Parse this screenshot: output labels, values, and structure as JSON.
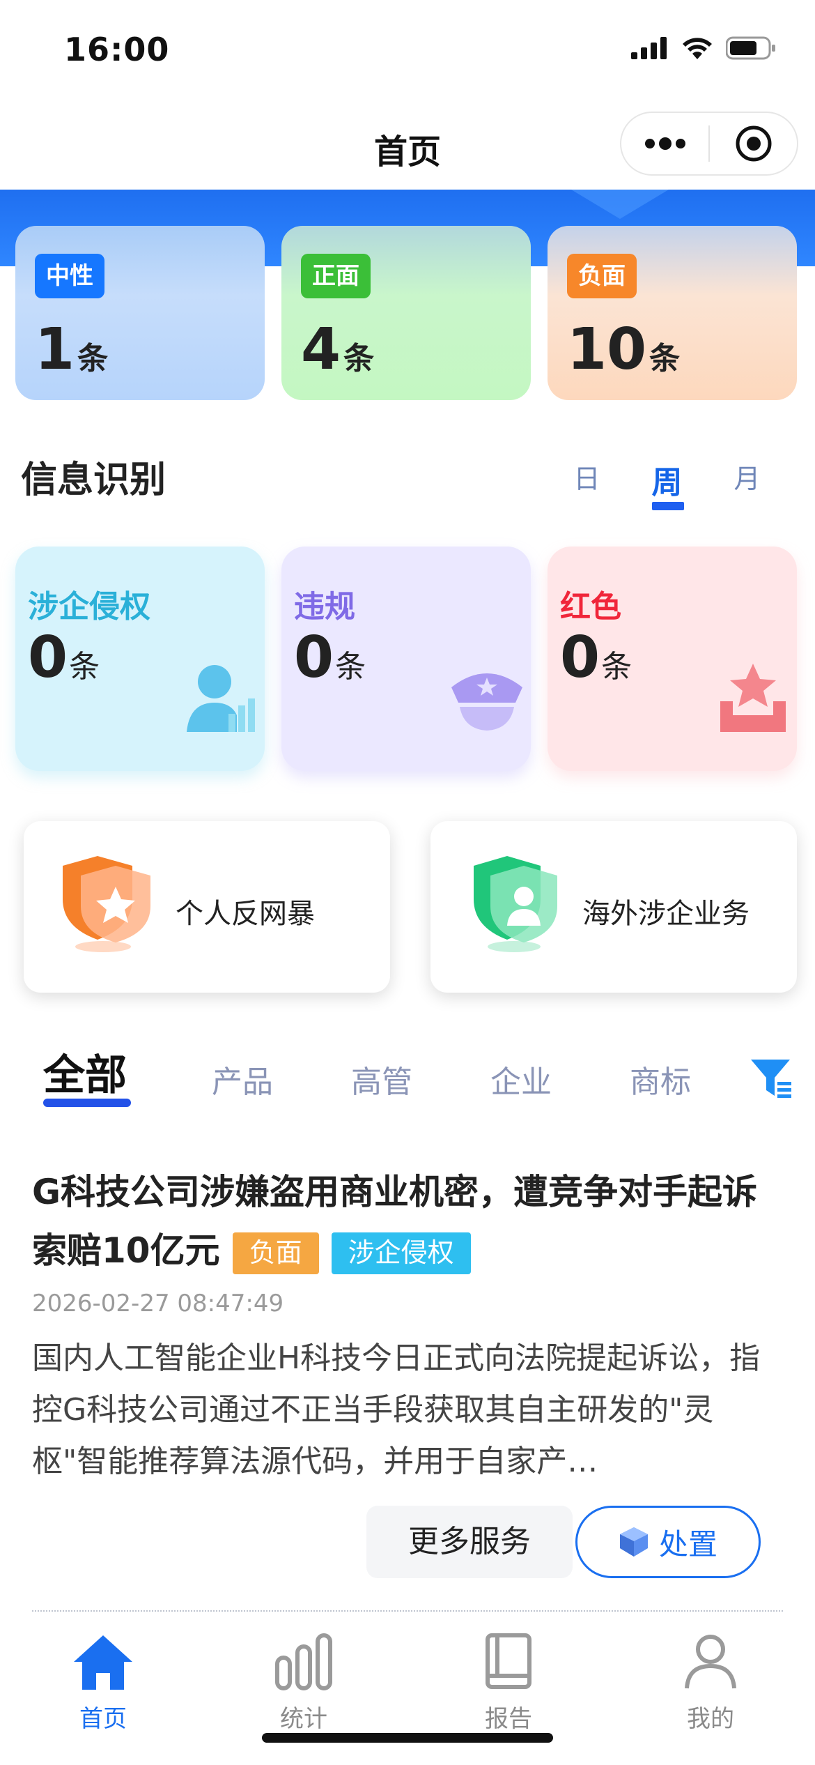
{
  "status_bar": {
    "time": "16:00"
  },
  "nav": {
    "title": "首页",
    "more_icon": "more-dots-icon",
    "target_icon": "target-icon"
  },
  "sentiment": [
    {
      "label": "中性",
      "count": "1",
      "unit": "条",
      "color": "#1677ff"
    },
    {
      "label": "正面",
      "count": "4",
      "unit": "条",
      "color": "#3bbf38"
    },
    {
      "label": "负面",
      "count": "10",
      "unit": "条",
      "color": "#f7872a"
    }
  ],
  "info_recognition": {
    "title": "信息识别",
    "period_tabs": [
      {
        "label": "日"
      },
      {
        "label": "周",
        "active": true
      },
      {
        "label": "月"
      }
    ],
    "cards": [
      {
        "label": "涉企侵权",
        "count": "0",
        "unit": "条",
        "icon": "person-chart-icon"
      },
      {
        "label": "违规",
        "count": "0",
        "unit": "条",
        "icon": "police-cap-icon"
      },
      {
        "label": "红色",
        "count": "0",
        "unit": "条",
        "icon": "star-tray-icon"
      }
    ]
  },
  "features": [
    {
      "label": "个人反网暴",
      "icon": "shield-star-icon"
    },
    {
      "label": "海外涉企业务",
      "icon": "shield-person-icon"
    }
  ],
  "categories": {
    "tabs": [
      {
        "label": "全部",
        "active": true
      },
      {
        "label": "产品"
      },
      {
        "label": "高管"
      },
      {
        "label": "企业"
      },
      {
        "label": "商标"
      }
    ],
    "filter_icon": "filter-icon"
  },
  "article": {
    "title": "G科技公司涉嫌盗用商业机密，遭竞争对手起诉索赔10亿元",
    "badges": [
      "负面",
      "涉企侵权"
    ],
    "time": "2026-02-27 08:47:49",
    "summary": "国内人工智能企业H科技今日正式向法院提起诉讼，指控G科技公司通过不正当手段获取其自主研发的\"灵枢\"智能推荐算法源代码，并用于自家产…",
    "more_button": "更多服务",
    "handle_button": "处置"
  },
  "tabbar": [
    {
      "label": "首页",
      "icon": "home-icon",
      "active": true
    },
    {
      "label": "统计",
      "icon": "bar-chart-icon"
    },
    {
      "label": "报告",
      "icon": "book-icon"
    },
    {
      "label": "我的",
      "icon": "user-icon"
    }
  ],
  "colors": {
    "accent": "#1a6ff0",
    "banner": "#2f86ff"
  }
}
